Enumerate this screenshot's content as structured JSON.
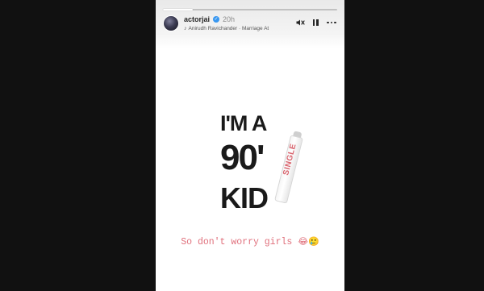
{
  "story": {
    "progress_fraction": 0.17,
    "username": "actorjai",
    "verified_icon": "verified-badge-icon",
    "time": "20h",
    "music_text": "Anirudh Ravichander · Marriage At",
    "controls": {
      "mute_icon": "volume-mute-icon",
      "pause_icon": "pause-icon",
      "more_icon": "more-options-icon"
    }
  },
  "graphic": {
    "line1": "I'M A",
    "line2": "90'",
    "line3": "KID",
    "cig_label": "SINGLE"
  },
  "caption": {
    "text": "So don't worry girls",
    "emojis": "😂🥲"
  },
  "colors": {
    "page_bg": "#111111",
    "story_bg": "#ffffff",
    "caption": "#e0707c",
    "verified": "#3897f0"
  }
}
